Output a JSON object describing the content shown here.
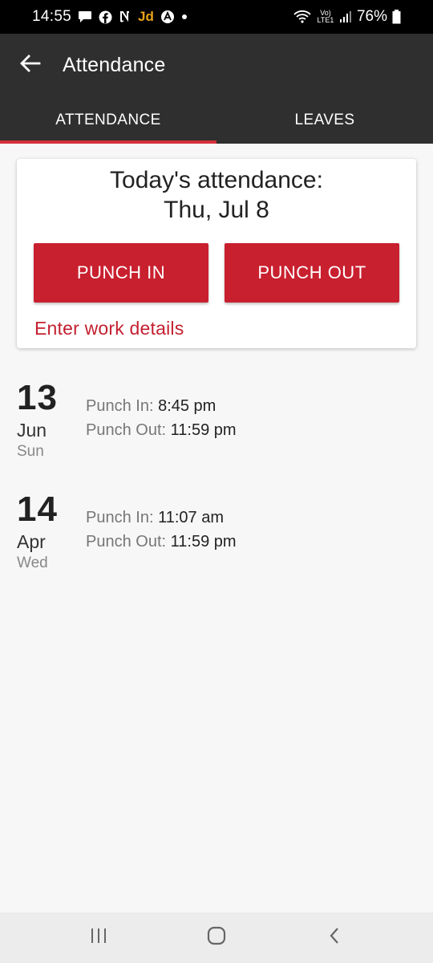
{
  "status_bar": {
    "time": "14:55",
    "jd_label": "Jd",
    "battery": "76%",
    "network_label": "Vo) LTE1"
  },
  "app_bar": {
    "title": "Attendance"
  },
  "tabs": [
    {
      "label": "ATTENDANCE",
      "active": true
    },
    {
      "label": "LEAVES",
      "active": false
    }
  ],
  "today_card": {
    "title_line1": "Today's attendance:",
    "title_line2": "Thu, Jul 8",
    "punch_in_label": "PUNCH IN",
    "punch_out_label": "PUNCH OUT",
    "work_details_link": "Enter work details"
  },
  "records": [
    {
      "day": "13",
      "month": "Jun",
      "weekday": "Sun",
      "punch_in_label": "Punch In:",
      "punch_in": "8:45 pm",
      "punch_out_label": "Punch Out:",
      "punch_out": "11:59 pm"
    },
    {
      "day": "14",
      "month": "Apr",
      "weekday": "Wed",
      "punch_in_label": "Punch In:",
      "punch_in": "11:07 am",
      "punch_out_label": "Punch Out:",
      "punch_out": "11:59 pm"
    }
  ],
  "colors": {
    "accent": "#c9202f",
    "app_bar": "#2f2f2f",
    "tab_indicator": "#d4313b"
  },
  "icons": {
    "back": "arrow-left-icon",
    "recents": "recents-icon",
    "home": "home-icon",
    "nav_back": "chevron-left-icon"
  }
}
